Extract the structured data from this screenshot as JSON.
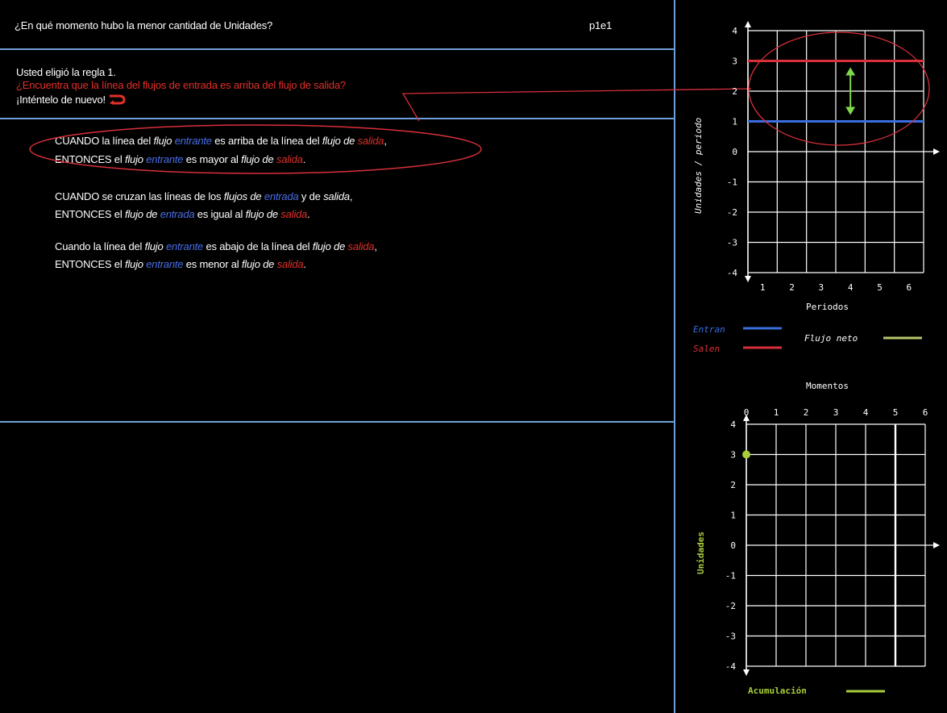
{
  "header": {
    "question": "¿En qué momento hubo la menor cantidad de Unidades?",
    "code": "p1e1"
  },
  "feedback": {
    "line1": "Usted eligió la regla 1.",
    "line2": "¿Encuentra que la línea del flujos de entrada es arriba del flujo de salida?",
    "line3": "¡Inténtelo de nuevo!"
  },
  "rules": {
    "r1": {
      "a": "CUANDO la línea del ",
      "b": "flujo",
      "c": "entrante",
      "d": " es arriba de la línea del ",
      "e": "flujo de",
      "f": "salida",
      "g": ",",
      "h": "ENTONCES el ",
      "i": "flujo",
      "j": "entrante",
      "k": " es mayor al ",
      "l": "flujo de",
      "m": "salida",
      "n": "."
    },
    "r2": {
      "a": "CUANDO se cruzan las líneas de los ",
      "b": "flujos de",
      "c": "entrada",
      "d": " y de ",
      "e": "salida",
      "g": ",",
      "h": "ENTONCES el ",
      "i": "flujo de",
      "j": "entrada",
      "k": " es igual al ",
      "l": "flujo de",
      "m": "salida",
      "n": "."
    },
    "r3": {
      "a": "Cuando la línea del ",
      "b": "flujo",
      "c": "entrante",
      "d": " es abajo de la línea del ",
      "e": "flujo de",
      "f": "salida",
      "g": ",",
      "h": "ENTONCES el ",
      "i": "flujo",
      "j": "entrante",
      "k": " es menor al ",
      "l": "flujo de",
      "m": "salida",
      "n": "."
    }
  },
  "flow_chart": {
    "ylabel": "Unidades / periodo",
    "xlabel": "Periodos",
    "x_ticks": [
      "1",
      "2",
      "3",
      "4",
      "5",
      "6"
    ],
    "y_ticks": [
      "4",
      "3",
      "2",
      "1",
      "0",
      "-1",
      "-2",
      "-3",
      "-4"
    ],
    "legend": {
      "in": "Entran",
      "out": "Salen",
      "net": "Flujo neto"
    },
    "colors": {
      "in": "#3a6ee0",
      "out": "#d8303a",
      "net": "#b8c46a"
    }
  },
  "stock_chart": {
    "title": "Momentos",
    "ylabel": "Unidades",
    "x_ticks": [
      "0",
      "1",
      "2",
      "3",
      "4",
      "5",
      "6"
    ],
    "y_ticks": [
      "4",
      "3",
      "2",
      "1",
      "0",
      "-1",
      "-2",
      "-3",
      "-4"
    ],
    "legend": "Acumulación",
    "color": "#a8cc3a"
  },
  "chart_data": [
    {
      "type": "line",
      "xlabel": "Periodos",
      "ylabel": "Unidades / periodo",
      "x": [
        0,
        6
      ],
      "xlim": [
        0,
        6
      ],
      "ylim": [
        -4,
        4
      ],
      "grid": true,
      "series": [
        {
          "name": "Entran",
          "values": [
            1,
            1
          ]
        },
        {
          "name": "Salen",
          "values": [
            3,
            3
          ]
        }
      ]
    },
    {
      "type": "scatter",
      "title": "Momentos",
      "ylabel": "Unidades",
      "xlim": [
        0,
        6
      ],
      "ylim": [
        -4,
        4
      ],
      "grid": true,
      "series": [
        {
          "name": "Acumulación",
          "x": [
            0
          ],
          "values": [
            3
          ]
        }
      ]
    }
  ]
}
